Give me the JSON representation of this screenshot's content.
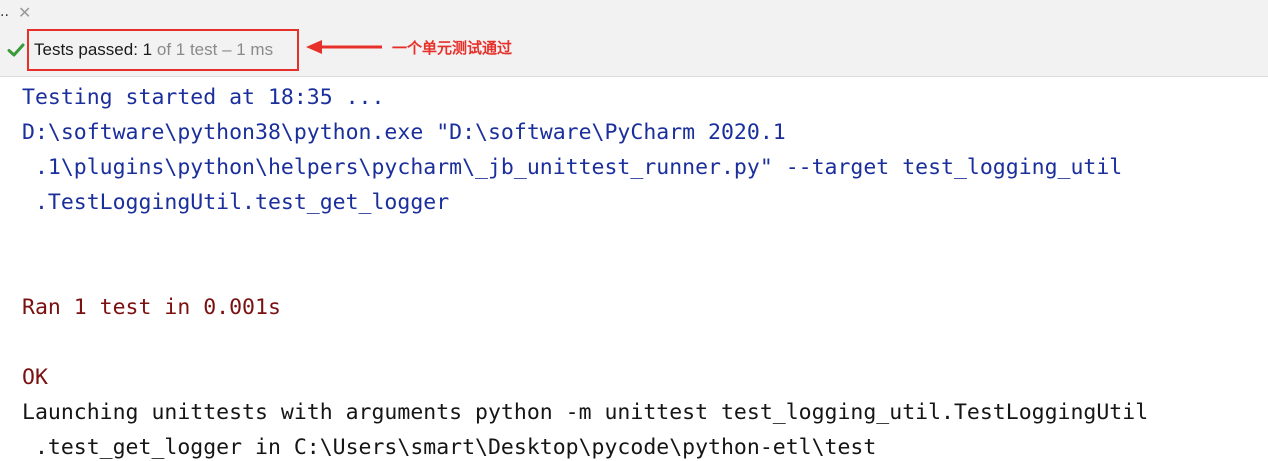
{
  "tab": {
    "ellipsis": "..",
    "close_glyph": "✕"
  },
  "status": {
    "icon": "check-icon",
    "label": "Tests passed: ",
    "passed": "1",
    "detail": " of 1 test – 1 ms"
  },
  "annotation": {
    "note": "一个单元测试通过",
    "color": "#e8302a"
  },
  "console": {
    "lines": [
      {
        "text": "Testing started at 18:35 ...",
        "style": "blue"
      },
      {
        "text": "D:\\software\\python38\\python.exe \"D:\\software\\PyCharm 2020.1",
        "style": "blue"
      },
      {
        "text": " .1\\plugins\\python\\helpers\\pycharm\\_jb_unittest_runner.py\" --target test_logging_util",
        "style": "blue"
      },
      {
        "text": " .TestLoggingUtil.test_get_logger",
        "style": "blue"
      },
      {
        "text": "Ran 1 test in 0.001s",
        "style": "dark-red"
      },
      {
        "text": "OK",
        "style": "dark-red"
      },
      {
        "text": "Launching unittests with arguments python -m unittest test_logging_util.TestLoggingUtil",
        "style": "dark"
      },
      {
        "text": " .test_get_logger in C:\\Users\\smart\\Desktop\\pycode\\python-etl\\test",
        "style": "dark"
      }
    ]
  },
  "colors": {
    "blue_text": "#1b2f9c",
    "dark_red_text": "#7a1010",
    "check_green": "#3a9a3a"
  }
}
